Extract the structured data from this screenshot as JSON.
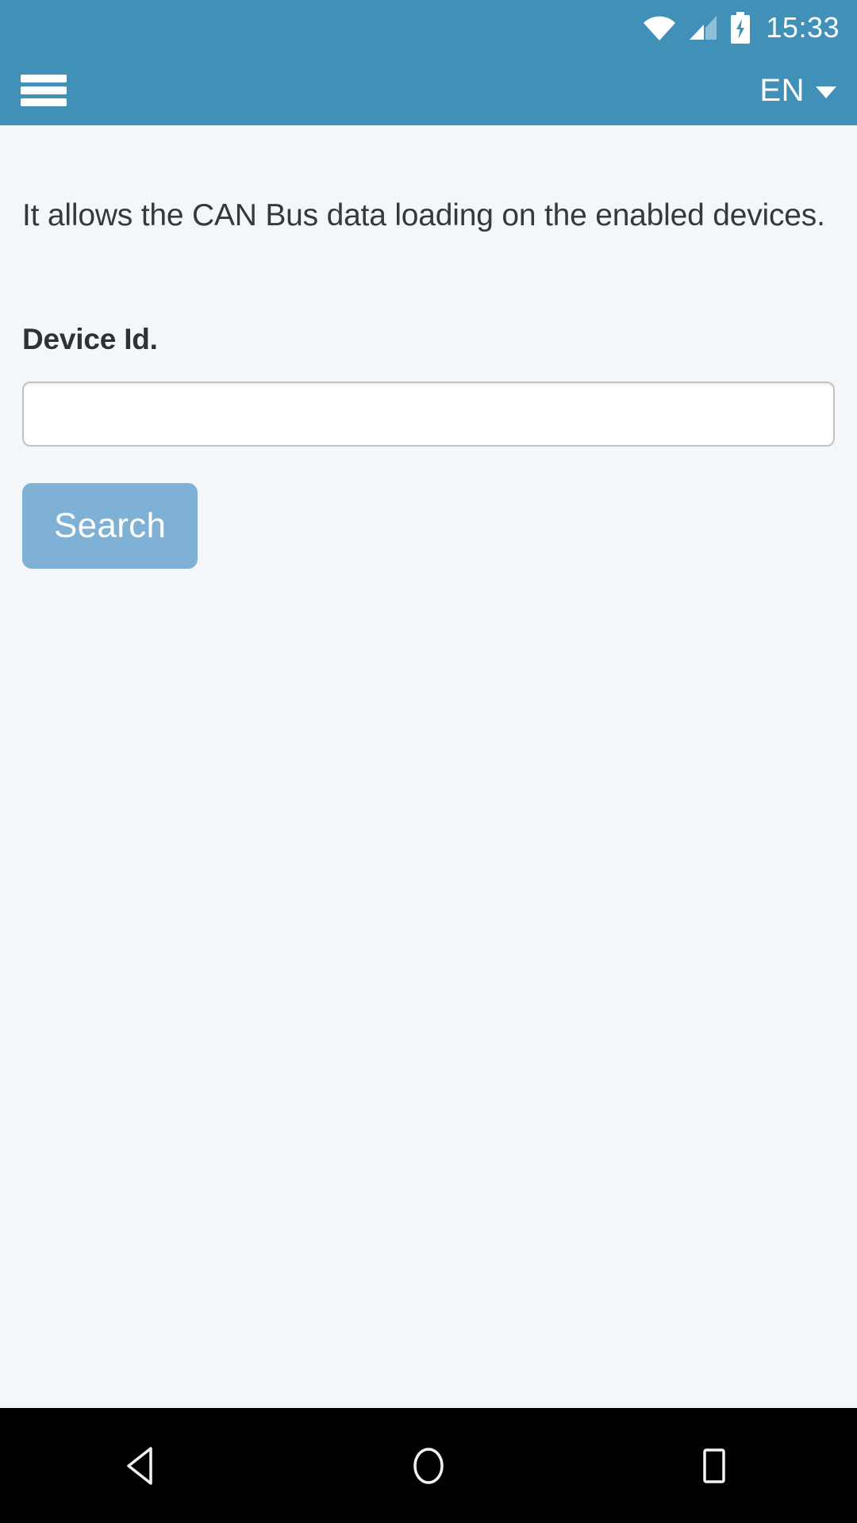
{
  "status_bar": {
    "time": "15:33",
    "icons": [
      "wifi-icon",
      "signal-icon",
      "battery-charging-icon"
    ]
  },
  "header": {
    "menu_icon": "hamburger-menu-icon",
    "language": "EN",
    "dropdown_icon": "chevron-down-icon"
  },
  "main": {
    "description": "It allows the CAN Bus data loading on the enabled devices.",
    "device_id_label": "Device Id.",
    "device_id_value": "",
    "device_id_placeholder": "",
    "search_button_label": "Search"
  },
  "nav_bar": {
    "back_label": "Back",
    "home_label": "Home",
    "recents_label": "Recent apps"
  },
  "colors": {
    "header_blue": "#4090B8",
    "button_blue": "#7FB0D6",
    "content_bg": "#F4F7F9",
    "text_dark": "#333A3E",
    "nav_bg": "#000000"
  }
}
